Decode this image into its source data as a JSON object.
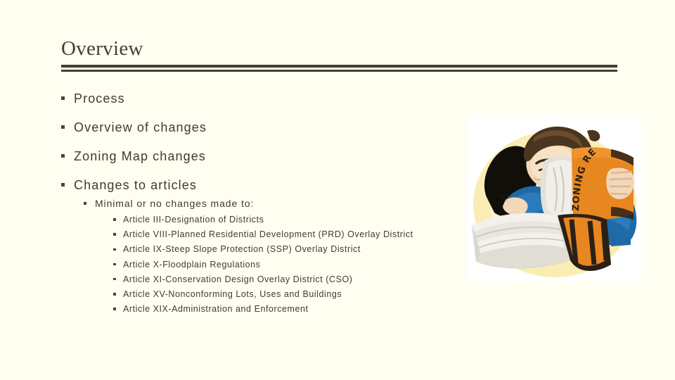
{
  "slide": {
    "title": "Overview",
    "background_color": "#fefff0",
    "text_color": "#3f3a30",
    "rule_color": "#443f33"
  },
  "bullets": [
    {
      "level": 1,
      "marker": "square-bullet",
      "text": "Process"
    },
    {
      "level": 1,
      "marker": "square-bullet",
      "text": "Overview of changes"
    },
    {
      "level": 1,
      "marker": "square-bullet",
      "text": "Zoning Map changes"
    },
    {
      "level": 1,
      "marker": "square-bullet",
      "text": "Changes to articles"
    },
    {
      "level": 2,
      "marker": "square-bullet",
      "text": "Minimal or no changes made to:"
    }
  ],
  "articles": [
    "Article III-Designation of Districts",
    "Article VIII-Planned Residential Development (PRD) Overlay District",
    "Article IX-Steep Slope Protection (SSP) Overlay District",
    "Article X-Floodplain Regulations",
    "Article XI-Conservation Design Overlay District (CSO)",
    "Article XV-Nonconforming Lots, Uses and Buildings",
    "Article XIX-Administration and Enforcement"
  ],
  "picture": {
    "name": "zoning-regulations-clipart",
    "alt": "Man in blue shirt reading a large orange book labeled ZONING REGULATIONS",
    "book_label": "ZONING REGULATIONS",
    "colors": {
      "book": "#e8861f",
      "shirt": "#1f6aa5",
      "hair": "#4a3520",
      "glow": "#f9e9a8",
      "pages": "#e8e6de",
      "background": "#ffffff"
    }
  }
}
